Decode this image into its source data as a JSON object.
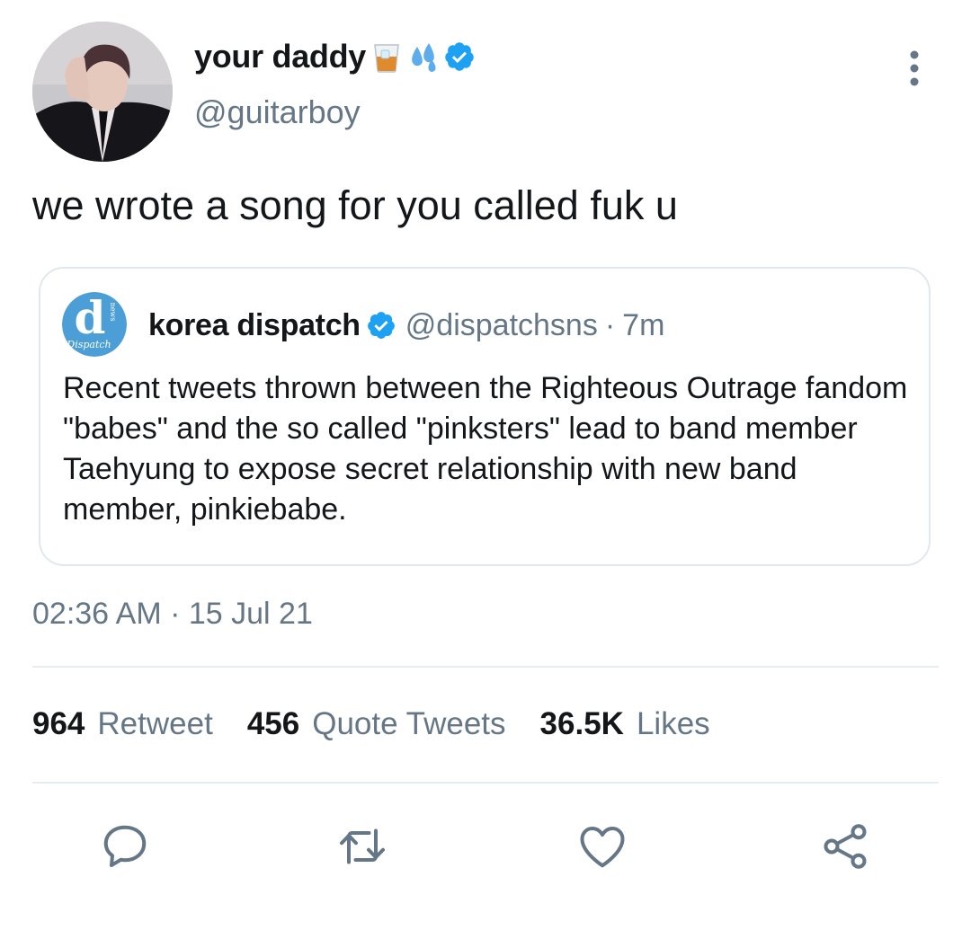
{
  "tweet": {
    "display_name": "your daddy",
    "name_emojis": [
      "tumbler-glass-emoji",
      "sweat-droplets-emoji"
    ],
    "verified": true,
    "handle": "@guitarboy",
    "text": "we wrote a song for you called fuk u",
    "timestamp": "02:36 AM · 15 Jul 21"
  },
  "quoted_tweet": {
    "avatar_letter": "d",
    "avatar_word": "Dispatch",
    "avatar_tag": "news",
    "display_name": "korea dispatch",
    "verified": true,
    "handle": "@dispatchsns",
    "separator": "·",
    "time_ago": "7m",
    "text": "Recent tweets thrown between the Righteous Outrage fandom \"babes\" and the so called \"pinksters\" lead to band member Taehyung to expose secret relationship with new band member, pinkiebabe."
  },
  "stats": {
    "retweets": {
      "count": "964",
      "label": "Retweet"
    },
    "quotes": {
      "count": "456",
      "label": "Quote Tweets"
    },
    "likes": {
      "count": "36.5K",
      "label": "Likes"
    }
  },
  "actions": [
    "reply-icon",
    "retweet-icon",
    "like-icon",
    "share-icon"
  ],
  "colors": {
    "verified_blue": "#1da1f2",
    "secondary_text": "#657786",
    "primary_text": "#14171a",
    "divider": "#e6ecf0"
  }
}
